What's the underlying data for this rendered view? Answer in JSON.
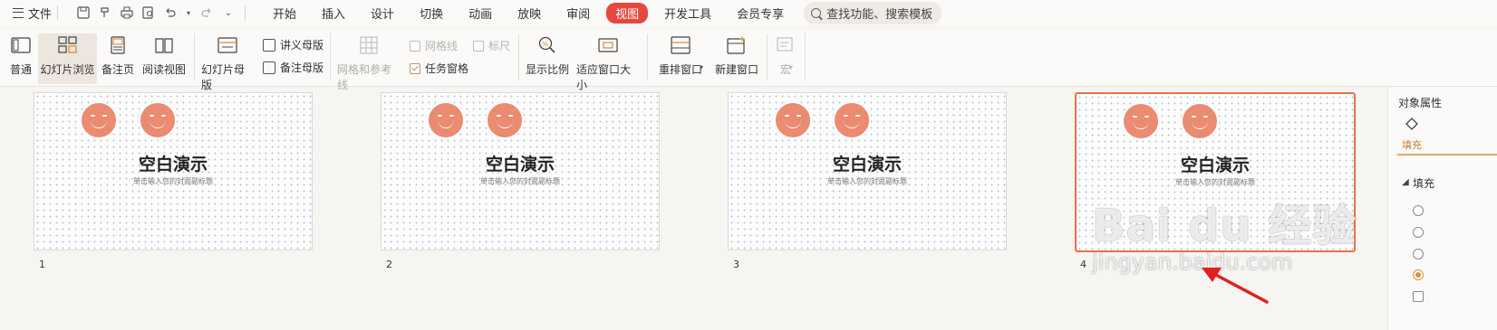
{
  "menu": {
    "file_label": "文件",
    "tabs": [
      {
        "label": "开始",
        "active": false
      },
      {
        "label": "插入",
        "active": false
      },
      {
        "label": "设计",
        "active": false
      },
      {
        "label": "切换",
        "active": false
      },
      {
        "label": "动画",
        "active": false
      },
      {
        "label": "放映",
        "active": false
      },
      {
        "label": "审阅",
        "active": false
      },
      {
        "label": "视图",
        "active": true
      },
      {
        "label": "开发工具",
        "active": false
      },
      {
        "label": "会员专享",
        "active": false
      }
    ],
    "search_placeholder": "查找功能、搜索模板",
    "quick_access_icons": [
      "save-icon",
      "format-painter-icon",
      "print-icon",
      "print-preview-icon",
      "undo-icon",
      "redo-icon",
      "customize-icon"
    ]
  },
  "ribbon": {
    "normal": "普通",
    "slide_sorter": "幻灯片浏览",
    "notes_page": "备注页",
    "reading_view": "阅读视图",
    "slide_master": "幻灯片母版",
    "handout_master": "讲义母版",
    "notes_master": "备注母版",
    "grid_guides": "网格和参考线",
    "gridlines": "网格线",
    "ruler": "标尺",
    "task_pane": "任务窗格",
    "zoom": "显示比例",
    "fit_window": "适应窗口大小",
    "arrange_windows": "重排窗口",
    "new_window": "新建窗口",
    "macro": "宏",
    "task_pane_checked": true,
    "gridlines_checked": false,
    "ruler_checked": false
  },
  "slides": [
    {
      "number": "1",
      "title": "空白演示",
      "subtitle": "单击输入您的封面副标题",
      "selected": false
    },
    {
      "number": "2",
      "title": "空白演示",
      "subtitle": "单击输入您的封面副标题",
      "selected": false
    },
    {
      "number": "3",
      "title": "空白演示",
      "subtitle": "单击输入您的封面副标题",
      "selected": false
    },
    {
      "number": "4",
      "title": "空白演示",
      "subtitle": "单击输入您的封面副标题",
      "selected": true
    }
  ],
  "right_panel": {
    "title": "对象属性",
    "fill_tab": "填充",
    "section": "填充"
  },
  "watermark": {
    "logo_text": "Bai du 经验",
    "url": "jingyan.baidu.com"
  },
  "colors": {
    "active_tab": "#e5483f",
    "selected_border": "#ec7046",
    "smiley": "#ea8b72",
    "arrow": "#e02020"
  }
}
